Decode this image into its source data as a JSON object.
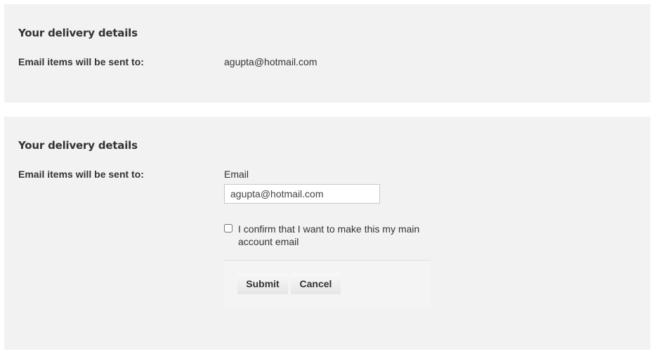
{
  "view_panel": {
    "heading": "Your delivery details",
    "label": "Email items will be sent to:",
    "email_value": "agupta@hotmail.com"
  },
  "edit_panel": {
    "heading": "Your delivery details",
    "label": "Email items will be sent to:",
    "field_label": "Email",
    "email_value": "agupta@hotmail.com",
    "confirm_text": "I confirm that I want to make this my main account email",
    "confirm_checked": false,
    "submit_label": "Submit",
    "cancel_label": "Cancel"
  },
  "colors": {
    "panel_background": "#f2f2f2",
    "text": "#333333",
    "input_border": "#c8c8c8"
  }
}
